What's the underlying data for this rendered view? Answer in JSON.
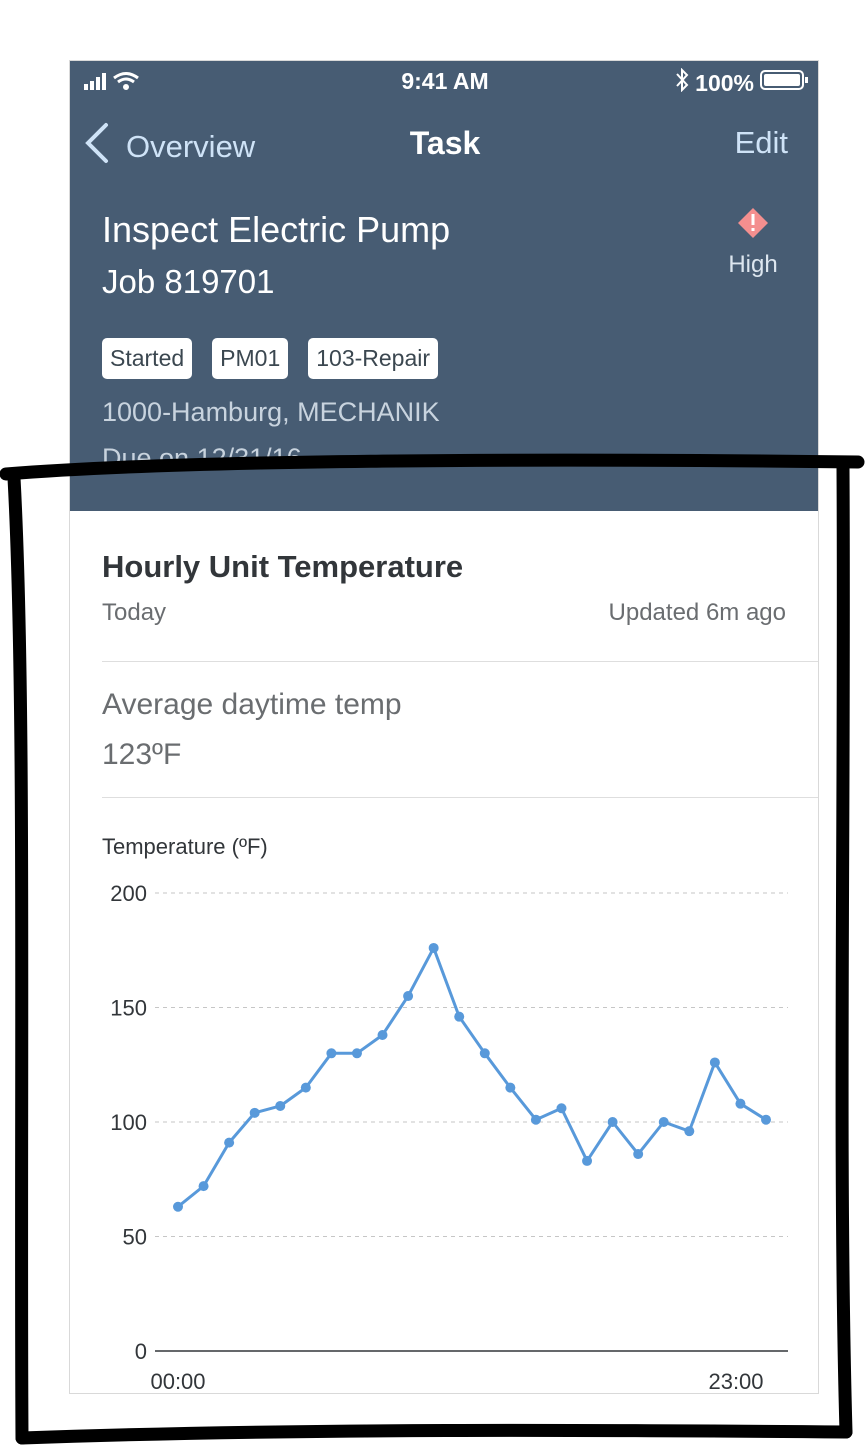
{
  "status_bar": {
    "time": "9:41 AM",
    "battery": "100%"
  },
  "nav": {
    "back_label": "Overview",
    "title": "Task",
    "edit_label": "Edit"
  },
  "task": {
    "title": "Inspect Electric Pump",
    "job": "Job 819701",
    "priority": "High",
    "tags": [
      "Started",
      "PM01",
      "103-Repair"
    ],
    "location": "1000-Hamburg, MECHANIK",
    "due": "Due on 12/31/16"
  },
  "card": {
    "title": "Hourly Unit Temperature",
    "period": "Today",
    "updated": "Updated 6m ago",
    "avg_label": "Average daytime temp",
    "avg_value": "123ºF"
  },
  "colors": {
    "header_bg": "#475c73",
    "series": "#5899da",
    "priority_icon": "#f48f8f",
    "link": "#cfe3f7"
  },
  "chart_data": {
    "type": "line",
    "ylabel": "Temperature (ºF)",
    "ylim": [
      0,
      200
    ],
    "yticks": [
      0,
      50,
      100,
      150,
      200
    ],
    "x_tick_labels": [
      "00:00",
      "23:00"
    ],
    "grid": true,
    "series": [
      {
        "values": [
          63,
          72,
          91,
          104,
          107,
          115,
          130,
          130,
          138,
          155,
          176,
          146,
          130,
          115,
          101,
          106,
          83,
          100,
          86,
          100,
          96,
          126,
          108,
          101
        ]
      }
    ]
  }
}
